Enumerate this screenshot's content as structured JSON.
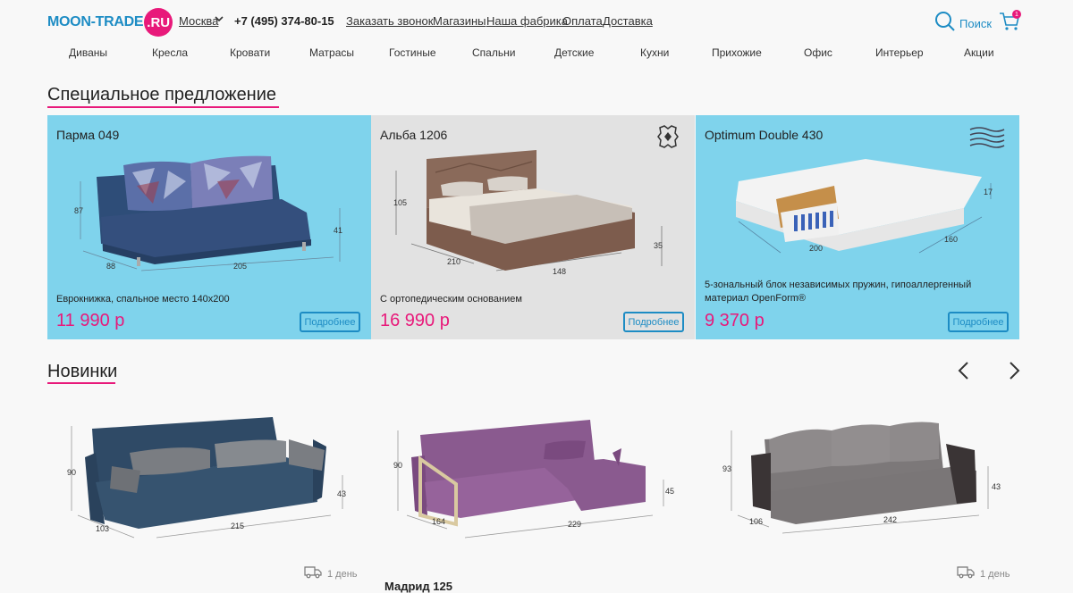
{
  "header": {
    "logo_text": "MOON-TRADE",
    "logo_badge": ".RU",
    "city": "Москва",
    "phone": "+7 (495) 374-80-15",
    "links": [
      "Заказать звонок",
      "Магазины",
      "Наша фабрика",
      "Оплата",
      "Доставка"
    ],
    "search_label": "Поиск",
    "cart_count": "1"
  },
  "nav": {
    "categories": [
      "Диваны",
      "Кресла",
      "Кровати",
      "Матрасы",
      "Гостиные",
      "Спальни",
      "Детские",
      "Кухни",
      "Прихожие",
      "Офис",
      "Интерьер",
      "Акции"
    ]
  },
  "special": {
    "title": "Специальное предложение",
    "cards": [
      {
        "name": "Парма 049",
        "desc": "Еврокнижка, спальное место 140х200",
        "price": "11 990 р",
        "button": "Подробнее",
        "bg": "#7fd3ec",
        "dims": [
          "87",
          "41",
          "88",
          "205"
        ]
      },
      {
        "name": "Альба 1206",
        "desc": "С ортопедическим основанием",
        "price": "16 990 р",
        "button": "Подробнее",
        "bg": "#e2e2e2",
        "dims": [
          "105",
          "35",
          "210",
          "148"
        ]
      },
      {
        "name": "Optimum Double 430",
        "desc": "5-зональный блок независимых пружин, гипоаллергенный материал OpenForm®",
        "price": "9 370 р",
        "button": "Подробнее",
        "bg": "#7fd3ec",
        "dims": [
          "17",
          "160",
          "200"
        ]
      }
    ]
  },
  "new_arrivals": {
    "title": "Новинки",
    "items": [
      {
        "dims": [
          "90",
          "43",
          "103",
          "215"
        ],
        "delivery": "1 день"
      },
      {
        "dims": [
          "90",
          "45",
          "164",
          "229"
        ]
      },
      {
        "dims": [
          "93",
          "43",
          "106",
          "242"
        ],
        "delivery": "1 день"
      }
    ],
    "product_title": "Мадрид 125"
  },
  "colors": {
    "accent_blue": "#1d8cc4",
    "accent_pink": "#e8197a"
  }
}
